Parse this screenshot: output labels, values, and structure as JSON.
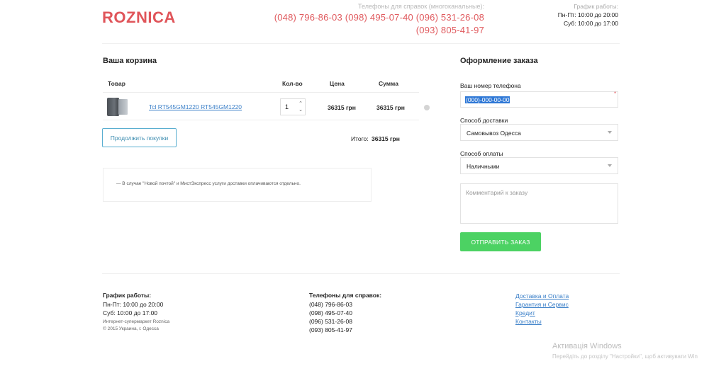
{
  "header": {
    "logo": "ROZNICA",
    "phones_label": "Телефоны для справок (многоканальные):",
    "phones_line1": "(048) 796-86-03 (098) 495-07-40 (096) 531-26-08",
    "phones_line2": "(093) 805-41-97",
    "hours_title": "График работы:",
    "hours_weekdays": "Пн-Пт: 10:00 до 20:00",
    "hours_saturday": "Суб: 10:00 до 17:00"
  },
  "cart": {
    "title": "Ваша корзина",
    "columns": [
      "Товар",
      "Кол-во",
      "Цена",
      "Сумма"
    ],
    "items": [
      {
        "name": "Tcl RT545GM1220 RT545GM1220",
        "qty": "1",
        "price": "36315 грн",
        "sum": "36315 грн"
      }
    ],
    "continue_label": "Продолжить покупки",
    "total_label": "Итого:",
    "total_value": "36315 грн",
    "note": "— В случае \"Новой почтой\" и МистЭкспресс услуги доставки оплачиваются отдельно."
  },
  "order": {
    "title": "Оформление заказа",
    "phone_label": "Ваш номер телефона",
    "phone_value": "(000)-000-00-00",
    "required_mark": "*",
    "delivery_label": "Способ доставки",
    "delivery_value": "Самовывоз Одесса",
    "payment_label": "Способ оплаты",
    "payment_value": "Наличными",
    "comment_placeholder": "Комментарий к заказу",
    "submit_label": "ОТПРАВИТЬ ЗАКАЗ"
  },
  "footer": {
    "hours_title": "График работы:",
    "hours_weekdays": "Пн-Пт: 10:00 до 20:00",
    "hours_saturday": "Суб: 10:00 до 17:00",
    "shop_name": "Интернет-супермаркет Roznica",
    "copyright": "© 2015 Украина, г. Одесса",
    "phones_title": "Телефоны для справок:",
    "phones": [
      "(048) 796-86-03",
      "(098) 495-07-40",
      "(096) 531-26-08",
      "(093) 805-41-97"
    ],
    "links": [
      "Доставка и Оплата",
      "Гарантия и Сервис",
      "Кредит",
      "Контакты"
    ]
  },
  "os": {
    "watermark_title": "Активація Windows",
    "watermark_text": "Перейдіть до розділу \"Настройки\", щоб активувати Win"
  },
  "colors": {
    "brand": "#e0555a",
    "link": "#3a7fc8",
    "submit": "#4cd263",
    "continue_border": "#5aaed0"
  }
}
